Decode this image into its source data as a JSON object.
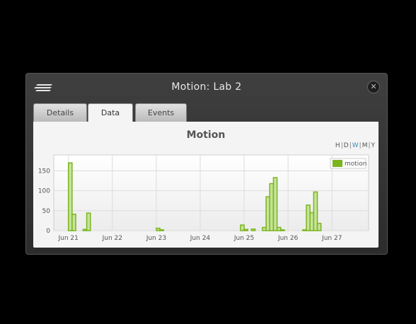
{
  "window": {
    "title": "Motion:  Lab 2",
    "close_icon": "close-icon"
  },
  "tabs": [
    {
      "label": "Details",
      "active": false
    },
    {
      "label": "Data",
      "active": true
    },
    {
      "label": "Events",
      "active": false
    }
  ],
  "ranges": [
    "H",
    "D",
    "W",
    "M",
    "Y"
  ],
  "selected_range": "W",
  "colors": {
    "bar_fill": "#c6e39a",
    "bar_stroke": "#7ab51d",
    "selected_range": "#3a8ab8"
  },
  "chart_data": {
    "type": "bar",
    "title": "Motion",
    "xlabel": "",
    "ylabel": "",
    "ylim": [
      0,
      190
    ],
    "yticks": [
      0,
      50,
      100,
      150
    ],
    "xlim": [
      "2016-06-20T16:00",
      "2016-06-27T20:00"
    ],
    "xticks": [
      {
        "label": "Jun 21",
        "x": "2016-06-21T00:00"
      },
      {
        "label": "Jun 22",
        "x": "2016-06-22T00:00"
      },
      {
        "label": "Jun 23",
        "x": "2016-06-23T00:00"
      },
      {
        "label": "Jun 24",
        "x": "2016-06-24T00:00"
      },
      {
        "label": "Jun 25",
        "x": "2016-06-25T00:00"
      },
      {
        "label": "Jun 26",
        "x": "2016-06-26T00:00"
      },
      {
        "label": "Jun 27",
        "x": "2016-06-27T00:00"
      }
    ],
    "grid": true,
    "legend": "top-right",
    "series": [
      {
        "name": "motion",
        "points": [
          {
            "x": "2016-06-21T00:00",
            "y": 170
          },
          {
            "x": "2016-06-21T02:00",
            "y": 41
          },
          {
            "x": "2016-06-21T08:00",
            "y": 3
          },
          {
            "x": "2016-06-21T10:00",
            "y": 44
          },
          {
            "x": "2016-06-23T00:00",
            "y": 6
          },
          {
            "x": "2016-06-23T02:00",
            "y": 2
          },
          {
            "x": "2016-06-24T22:00",
            "y": 14
          },
          {
            "x": "2016-06-25T00:00",
            "y": 3
          },
          {
            "x": "2016-06-25T04:00",
            "y": 4
          },
          {
            "x": "2016-06-25T10:00",
            "y": 8
          },
          {
            "x": "2016-06-25T12:00",
            "y": 85
          },
          {
            "x": "2016-06-25T14:00",
            "y": 118
          },
          {
            "x": "2016-06-25T16:00",
            "y": 133
          },
          {
            "x": "2016-06-25T18:00",
            "y": 8
          },
          {
            "x": "2016-06-25T20:00",
            "y": 2
          },
          {
            "x": "2016-06-26T08:00",
            "y": 2
          },
          {
            "x": "2016-06-26T10:00",
            "y": 64
          },
          {
            "x": "2016-06-26T12:00",
            "y": 45
          },
          {
            "x": "2016-06-26T14:00",
            "y": 97
          },
          {
            "x": "2016-06-26T16:00",
            "y": 18
          }
        ]
      }
    ]
  }
}
